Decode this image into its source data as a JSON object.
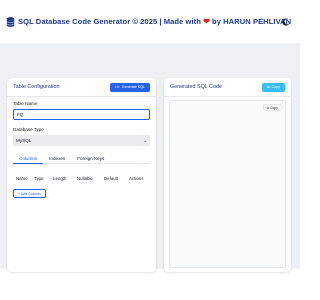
{
  "header": {
    "title_prefix": "SQL Database Code Generator © 2025 | Made with ",
    "heart": "❤",
    "title_suffix": " by HARUN PEHLIVAN",
    "logo_icon": "database-icon",
    "theme_icon": "moon-icon"
  },
  "left_card": {
    "title": "Table Configuration",
    "generate_label": "Generate SQL",
    "table_name_label": "Table Name",
    "table_name_value": "FQ",
    "db_type_label": "Database Type",
    "db_type_value": "MySQL",
    "tabs": [
      "Columns",
      "Indexes",
      "Foreign Keys"
    ],
    "active_tab": "Columns",
    "columns_header": [
      "Name",
      "Type",
      "Length",
      "Nullable",
      "Default",
      "Actions"
    ],
    "add_column_label": "+ Add Column"
  },
  "right_card": {
    "title": "Generated SQL Code",
    "copy_label": "Copy",
    "inner_copy_label": "Copy"
  },
  "colors": {
    "accent": "#2563eb",
    "title": "#1e3a8a",
    "copy": "#38bdf8",
    "heart": "#dc2626"
  }
}
